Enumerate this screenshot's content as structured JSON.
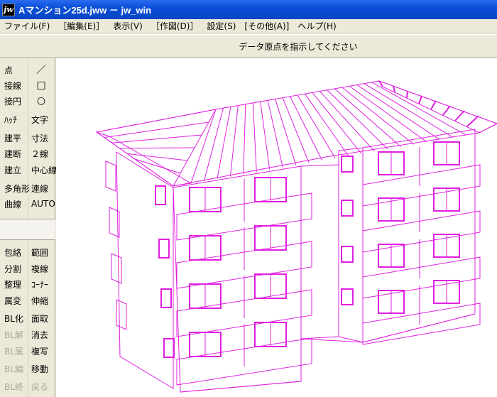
{
  "window": {
    "icon_label": "jw",
    "title": "Aマンション25d.jww － jw_win"
  },
  "menu": [
    "ファイル(F)",
    "［編集(E)］",
    "表示(V)",
    "［作図(D)］",
    "設定(S)",
    "[その他(A)]",
    "ヘルプ(H)"
  ],
  "status": {
    "message": "データ原点を指示してください"
  },
  "tools_col1": [
    {
      "label": "点",
      "enabled": true
    },
    {
      "label": "接線",
      "enabled": true
    },
    {
      "label": "接円",
      "enabled": true
    },
    {
      "label": "ﾊｯﾁ",
      "enabled": true
    },
    {
      "label": "建平",
      "enabled": true
    },
    {
      "label": "建断",
      "enabled": true
    },
    {
      "label": "建立",
      "enabled": true
    },
    {
      "label": "多角形",
      "enabled": true
    },
    {
      "label": "曲線",
      "enabled": true
    },
    {
      "label": "包絡",
      "enabled": true
    },
    {
      "label": "分割",
      "enabled": true
    },
    {
      "label": "整理",
      "enabled": true
    },
    {
      "label": "属変",
      "enabled": true
    },
    {
      "label": "BL化",
      "enabled": true
    },
    {
      "label": "BL解",
      "enabled": false
    },
    {
      "label": "BL属",
      "enabled": false
    },
    {
      "label": "BL編",
      "enabled": false
    },
    {
      "label": "BL終",
      "enabled": false
    }
  ],
  "tools_col2": [
    {
      "label": "／",
      "enabled": true
    },
    {
      "label": "□",
      "enabled": true
    },
    {
      "label": "○",
      "enabled": true
    },
    {
      "label": "文字",
      "enabled": true
    },
    {
      "label": "寸法",
      "enabled": true
    },
    {
      "label": "２線",
      "enabled": true
    },
    {
      "label": "中心線",
      "enabled": true
    },
    {
      "label": "連線",
      "enabled": true
    },
    {
      "label": "AUTO",
      "enabled": true
    },
    {
      "label": "範囲",
      "enabled": true
    },
    {
      "label": "複線",
      "enabled": true
    },
    {
      "label": "ｺｰﾅｰ",
      "enabled": true
    },
    {
      "label": "伸縮",
      "enabled": true
    },
    {
      "label": "面取",
      "enabled": true
    },
    {
      "label": "消去",
      "enabled": true
    },
    {
      "label": "複写",
      "enabled": true
    },
    {
      "label": "移動",
      "enabled": true
    },
    {
      "label": "戻る",
      "enabled": false
    }
  ],
  "colors": {
    "line": "#e020e0",
    "canvas": "#ffffff",
    "disabled_text": "#aca899"
  }
}
